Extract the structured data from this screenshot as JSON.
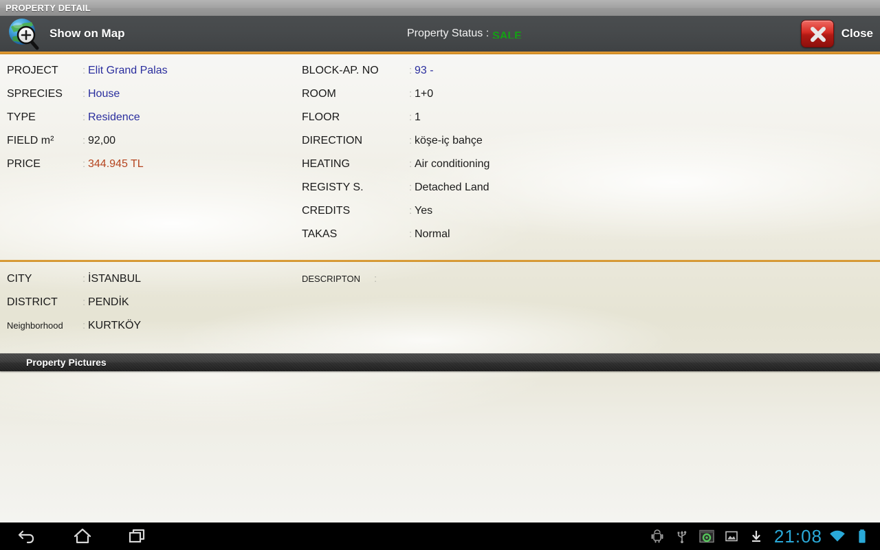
{
  "window": {
    "title": "PROPERTY DETAIL"
  },
  "actionbar": {
    "map_icon": "globe-zoom-icon",
    "show_on_map_label": "Show on Map",
    "status_label": "Property Status :",
    "status_value": "SALE",
    "status_color": "#14a014",
    "close_icon": "close-x-icon",
    "close_label": "Close"
  },
  "details": {
    "left": [
      {
        "label": "PROJECT",
        "separator": ":",
        "value": "Elit Grand Palas",
        "style": "blue"
      },
      {
        "label": "SPRECIES",
        "separator": ":",
        "value": "House",
        "style": "blue"
      },
      {
        "label": "TYPE",
        "separator": ":",
        "value": "Residence",
        "style": "blue"
      },
      {
        "label": "FIELD m²",
        "separator": ":",
        "value": "92,00",
        "style": "dark"
      },
      {
        "label": "PRICE",
        "separator": ":",
        "value": "344.945 TL",
        "style": "red"
      }
    ],
    "right": [
      {
        "label": "BLOCK-AP. NO",
        "separator": ":",
        "value": "93 -",
        "style": "blue"
      },
      {
        "label": "ROOM",
        "separator": ":",
        "value": "1+0",
        "style": "dark"
      },
      {
        "label": "FLOOR",
        "separator": ":",
        "value": "1",
        "style": "dark"
      },
      {
        "label": "DIRECTION",
        "separator": ":",
        "value": "köşe-iç bahçe",
        "style": "dark"
      },
      {
        "label": "HEATING",
        "separator": ":",
        "value": "Air conditioning",
        "style": "dark"
      },
      {
        "label": "REGISTY S.",
        "separator": ":",
        "value": "Detached Land",
        "style": "dark"
      },
      {
        "label": "CREDITS",
        "separator": ":",
        "value": "Yes",
        "style": "dark"
      },
      {
        "label": "TAKAS",
        "separator": ":",
        "value": "Normal",
        "style": "dark"
      }
    ]
  },
  "location": {
    "rows": [
      {
        "label": "CITY",
        "separator": ":",
        "value": "İSTANBUL",
        "small": false
      },
      {
        "label": "DISTRICT",
        "separator": ":",
        "value": "PENDİK",
        "small": false
      },
      {
        "label": "Neighborhood",
        "separator": ":",
        "value": "KURTKÖY",
        "small": true
      }
    ],
    "description_label": "DESCRIPTON",
    "description_separator": ":",
    "description_value": ""
  },
  "pictures": {
    "header": "Property Pictures"
  },
  "systembar": {
    "nav": [
      {
        "name": "back-icon",
        "label": "Back"
      },
      {
        "name": "home-icon",
        "label": "Home"
      },
      {
        "name": "recents-icon",
        "label": "Recent apps"
      }
    ],
    "status_icons": [
      {
        "name": "android-debug-icon",
        "label": "USB debugging"
      },
      {
        "name": "usb-icon",
        "label": "USB connected"
      },
      {
        "name": "screen-recorder-icon",
        "label": "Screen recorder"
      },
      {
        "name": "screenshot-icon",
        "label": "Screenshot saved"
      },
      {
        "name": "download-icon",
        "label": "Download complete"
      }
    ],
    "clock": "21:08",
    "wifi_icon": "wifi-icon",
    "battery_icon": "battery-full-icon",
    "clock_color": "#2aa9d8"
  }
}
